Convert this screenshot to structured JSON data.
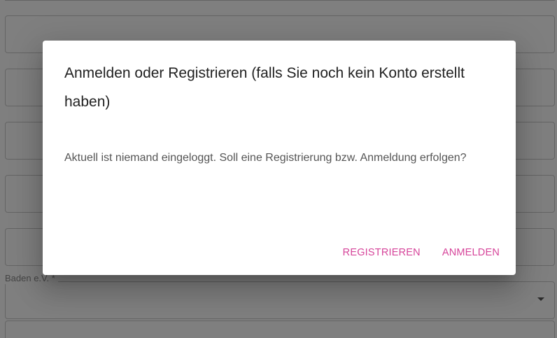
{
  "background_form": {
    "partial_field_label": "Baden e.V. *"
  },
  "dialog": {
    "title": "Anmelden oder Registrieren (falls Sie noch kein Konto erstellt haben)",
    "message": "Aktuell ist niemand eingeloggt. Soll eine Registrierung bzw. Anmeldung erfolgen?",
    "actions": {
      "register_label": "REGISTRIEREN",
      "login_label": "ANMELDEN"
    }
  },
  "colors": {
    "accent": "#d6449a",
    "scrim": "rgba(0,0,0,0.5)"
  }
}
